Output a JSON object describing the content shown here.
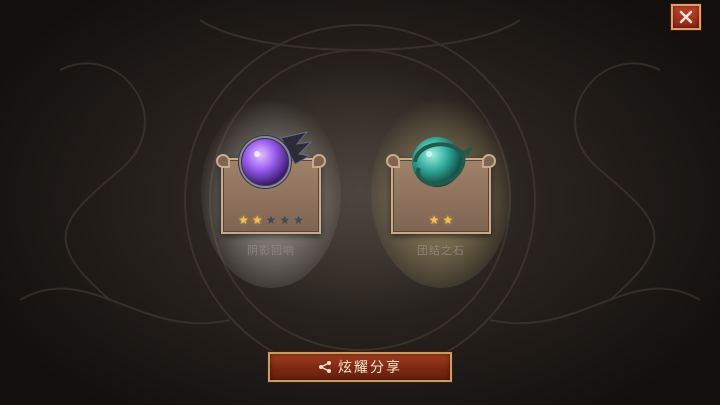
{
  "close": {
    "icon": "close-icon"
  },
  "rewards": [
    {
      "name": "阴影回响",
      "stars_filled": 2,
      "stars_total": 5,
      "orb_icon": "purple-shadow-orb-icon",
      "orb_color": "#9a5cf0",
      "glow_color": "#ffffff"
    },
    {
      "name": "团结之石",
      "stars_filled": 2,
      "stars_total": 2,
      "orb_icon": "teal-serpent-stone-icon",
      "orb_color": "#2fa89a",
      "glow_color": "#f0d890"
    }
  ],
  "share": {
    "label": "炫耀分享",
    "icon": "share-icon"
  },
  "colors": {
    "accent": "#a8401f",
    "border_gold": "#c89a68",
    "star": "#f3c24a"
  }
}
